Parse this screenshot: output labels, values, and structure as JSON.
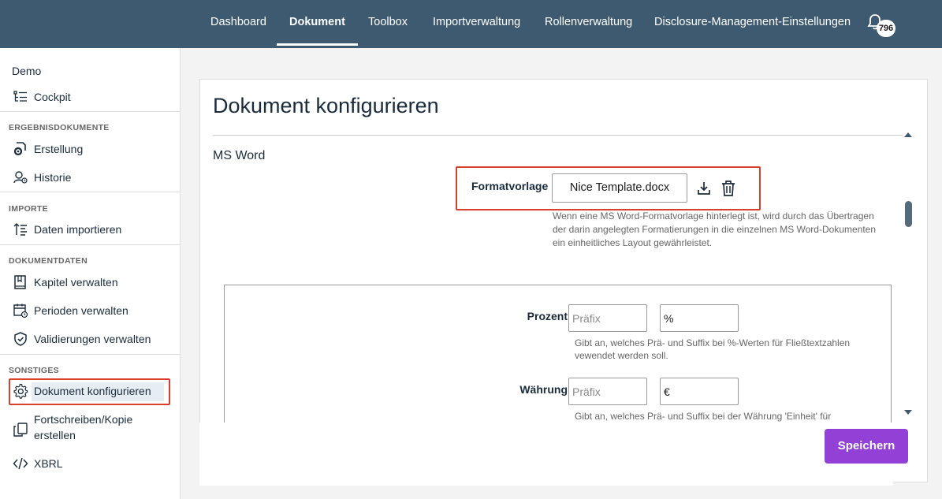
{
  "nav": {
    "items": [
      "Dashboard",
      "Dokument",
      "Toolbox",
      "Importverwaltung",
      "Rollenverwaltung",
      "Disclosure-Management-Einstellungen"
    ],
    "active": "Dokument",
    "notification_count": "796"
  },
  "sidebar": {
    "project": "Demo",
    "cockpit": "Cockpit",
    "sections": {
      "ergebnis": "ERGEBNISDOKUMENTE",
      "importe": "IMPORTE",
      "dokumentdaten": "DOKUMENTDATEN",
      "sonstiges": "SONSTIGES"
    },
    "items": {
      "erstellung": "Erstellung",
      "historie": "Historie",
      "daten_importieren": "Daten importieren",
      "kapitel": "Kapitel verwalten",
      "perioden": "Perioden verwalten",
      "validierungen": "Validierungen verwalten",
      "dokument_konfigurieren": "Dokument konfigurieren",
      "fortschreiben_1": "Fortschreiben/Kopie",
      "fortschreiben_2": "erstellen",
      "xbrl": "XBRL"
    }
  },
  "main": {
    "title": "Dokument konfigurieren",
    "section": "MS Word",
    "formatvorlage": {
      "label": "Formatvorlage",
      "file": "Nice Template.docx",
      "help": "Wenn eine MS Word-Formatvorlage hinterlegt ist, wird durch das Übertragen der darin angelegten Formatierungen in die einzelnen MS Word-Dokumenten ein einheitliches Layout gewährleistet."
    },
    "prozent": {
      "label": "Prozent",
      "prefix_placeholder": "Präfix",
      "suffix_value": "%",
      "help": "Gibt an, welches Prä- und Suffix bei %-Werten für Fließtextzahlen vewendet werden soll."
    },
    "waehrung": {
      "label": "Währung",
      "prefix_placeholder": "Präfix",
      "suffix_value": "€",
      "help": "Gibt an, welches Prä- und Suffix bei der Währung 'Einheit' für"
    },
    "save_label": "Speichern"
  }
}
